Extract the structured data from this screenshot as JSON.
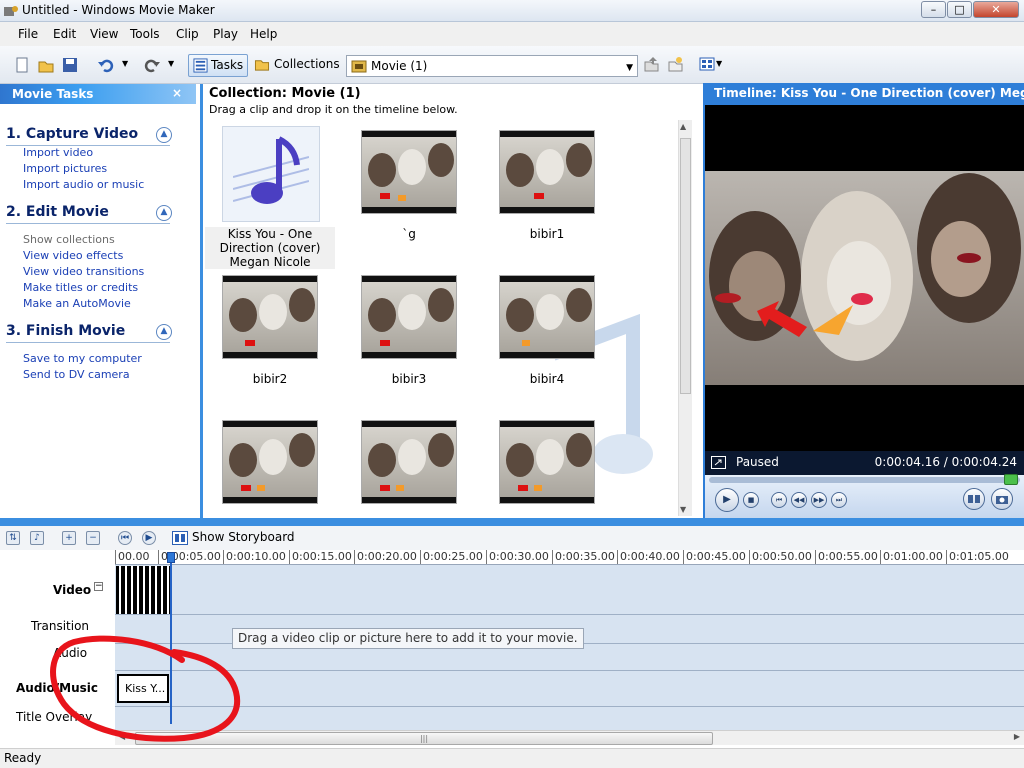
{
  "window": {
    "title": "Untitled - Windows Movie Maker",
    "minimize": "–",
    "maximize": "□",
    "close": "✕"
  },
  "menu": [
    "File",
    "Edit",
    "View",
    "Tools",
    "Clip",
    "Play",
    "Help"
  ],
  "toolbar": {
    "tasks_label": "Tasks",
    "collections_label": "Collections",
    "collection_select": "Movie (1)"
  },
  "taskpane": {
    "header": "Movie Tasks",
    "close": "×",
    "sections": [
      {
        "title": "1. Capture Video",
        "links": [
          "Import video",
          "Import pictures",
          "Import audio or music"
        ]
      },
      {
        "title": "2. Edit Movie",
        "links": [
          "Show collections",
          "View video effects",
          "View video transitions",
          "Make titles or credits",
          "Make an AutoMovie"
        ]
      },
      {
        "title": "3. Finish Movie",
        "links": [
          "Save to my computer",
          "Send to DV camera"
        ]
      }
    ]
  },
  "collection": {
    "title": "Collection: Movie (1)",
    "subtitle": "Drag a clip and drop it on the timeline below.",
    "items": [
      "Kiss You - One Direction (cover) Megan Nicole",
      "`g",
      "bibir1",
      "bibir2",
      "bibir3",
      "bibir4",
      "",
      "",
      ""
    ]
  },
  "monitor": {
    "title": "Timeline: Kiss You - One Direction (cover) Megan",
    "status": "Paused",
    "time": "0:00:04.16 / 0:00:04.24"
  },
  "timeline": {
    "show_storyboard": "Show Storyboard",
    "ruler": [
      "00.00",
      "0:00:05.00",
      "0:00:10.00",
      "0:00:15.00",
      "0:00:20.00",
      "0:00:25.00",
      "0:00:30.00",
      "0:00:35.00",
      "0:00:40.00",
      "0:00:45.00",
      "0:00:50.00",
      "0:00:55.00",
      "0:01:00.00",
      "0:01:05.00"
    ],
    "tracks": {
      "video": "Video",
      "transition": "Transition",
      "audio": "Audio",
      "audio_music": "Audio/Music",
      "title_overlay": "Title Overlay"
    },
    "hint": "Drag a video clip or picture here to add it to your movie.",
    "audio_clip": "Kiss Y..."
  },
  "statusbar": "Ready",
  "colors": {
    "accent": "#3b8ee0",
    "annotation": "#e8141b",
    "link": "#1a3fb5"
  }
}
